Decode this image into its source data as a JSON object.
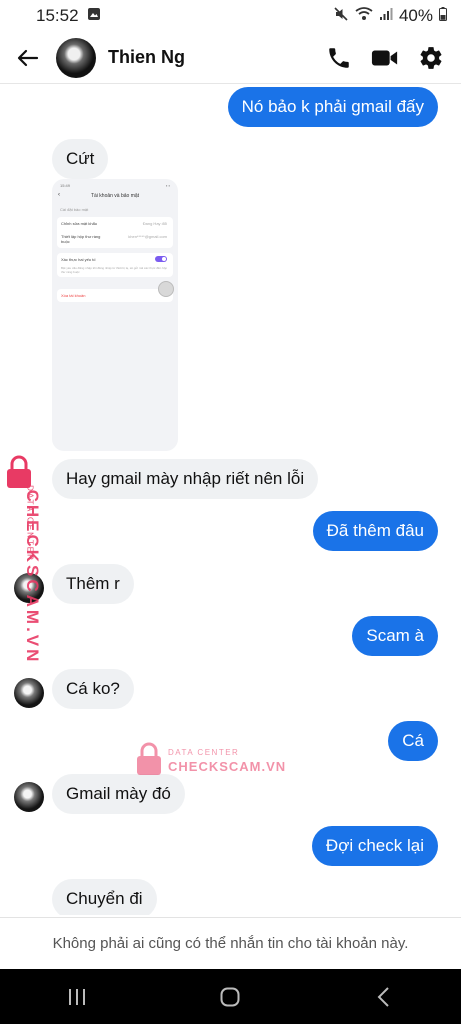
{
  "status_bar": {
    "time": "15:52",
    "battery": "40%",
    "icons": [
      "image-icon",
      "mute-icon",
      "wifi-icon",
      "signal-icon",
      "battery-icon"
    ]
  },
  "header": {
    "contact_name": "Thien Ng",
    "icons": [
      "back-arrow-icon",
      "phone-icon",
      "video-icon",
      "gear-icon"
    ]
  },
  "messages": [
    {
      "side": "out",
      "text": "Nó bảo k phải gmail đấy"
    },
    {
      "side": "in",
      "text": "Cứt"
    },
    {
      "side": "in",
      "type": "image"
    },
    {
      "side": "in",
      "text": "Hay gmail mày nhập riết nên lỗi"
    },
    {
      "side": "out",
      "text": "Đã thêm đâu"
    },
    {
      "side": "in",
      "text": "Thêm r"
    },
    {
      "side": "out",
      "text": "Scam à"
    },
    {
      "side": "in",
      "text": "Cá ko?"
    },
    {
      "side": "out",
      "text": "Cá"
    },
    {
      "side": "in",
      "text": "Gmail mày đó"
    },
    {
      "side": "out",
      "text": "Đợi check lại"
    },
    {
      "side": "in",
      "text": "Chuyển đi"
    }
  ],
  "embedded_screenshot": {
    "time": "15:49",
    "title": "Tài khoản và bảo mật",
    "section": "Cài đặt bảo mật",
    "rows": [
      {
        "label": "Chỉnh sửa mật khẩu",
        "value": "Đang Hay đổi"
      },
      {
        "label": "Thiết lập hộp thư ràng buộc",
        "value": "khen*****@gmail.com"
      }
    ],
    "toggle_label": "Xác thực hai yếu tố",
    "toggle_note": "Bật yêu cầu đăng nhập khi đăng nhập từ thiết bị lạ, sẽ gửi mã xác thực đến hộp thư ràng buộc",
    "delete_label": "Xóa tài khoản"
  },
  "watermark": {
    "sub": "DATA CENTER",
    "main": "CHECKSCAM.VN",
    "color": "#e83a64"
  },
  "footer": {
    "notice": "Không phải ai cũng có thể nhắn tin cho tài khoản này."
  },
  "colors": {
    "outgoing_bubble": "#1a73e8",
    "incoming_bubble": "#eff1f3"
  }
}
